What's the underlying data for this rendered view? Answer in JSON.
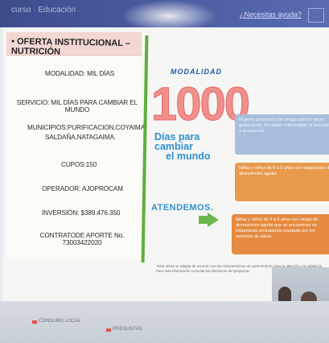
{
  "topbar": {
    "title": "curso · Educación",
    "help": "¿Necesitas ayuda?"
  },
  "slide": {
    "header": "• OFERTA INSTITUCIONAL – NUTRICIÓN",
    "lines": [
      "MODALIDAD: MIL DÍAS",
      "SERVICIO: MIL DÍAS PARA CAMBIAR  EL MUNDO",
      "MUNICIPIOS:PURIFICACION,COYAIMA,",
      "SALDAÑA,NATAGAIMA.",
      "CUPOS:150",
      "OPERADOR: AJOPROCAM",
      "INVERSIÓN: $389.476.350",
      "CONTRATODE APORTE No. 73003422020"
    ],
    "mid": {
      "modalidad": "MODALIDAD",
      "big": "1000",
      "dias": "Días para cambiar",
      "dias2": "el mundo",
      "atendemos": "ATENDEMOS."
    },
    "boxes": [
      "Mujeres gestantes con riesgo para la salud gestacional. Sin haber enfermedad ni asociada a la carencia.",
      "Niñas y niños de 0 a 5 años con diagnóstico de desnutrición aguda.",
      "Niñas y niños de 0 a 5 años con riesgo de desnutrición aguda que se encuentran en tratamiento ambulatorio prestado por los servicios de salud."
    ],
    "footnote": "*Esta oferta se adapta de acuerdo con las características de cada territorio para la atención a la población. Para más información consulta las directrices del programa."
  },
  "bottom": {
    "left": "CONSUMO LOCAL",
    "right": "PREGUNTAS"
  },
  "colors": {
    "accent_green": "#5fae3c",
    "header_pink": "#f3d7d2",
    "orange": "#e79a4c",
    "blue": "#a8bedc"
  }
}
